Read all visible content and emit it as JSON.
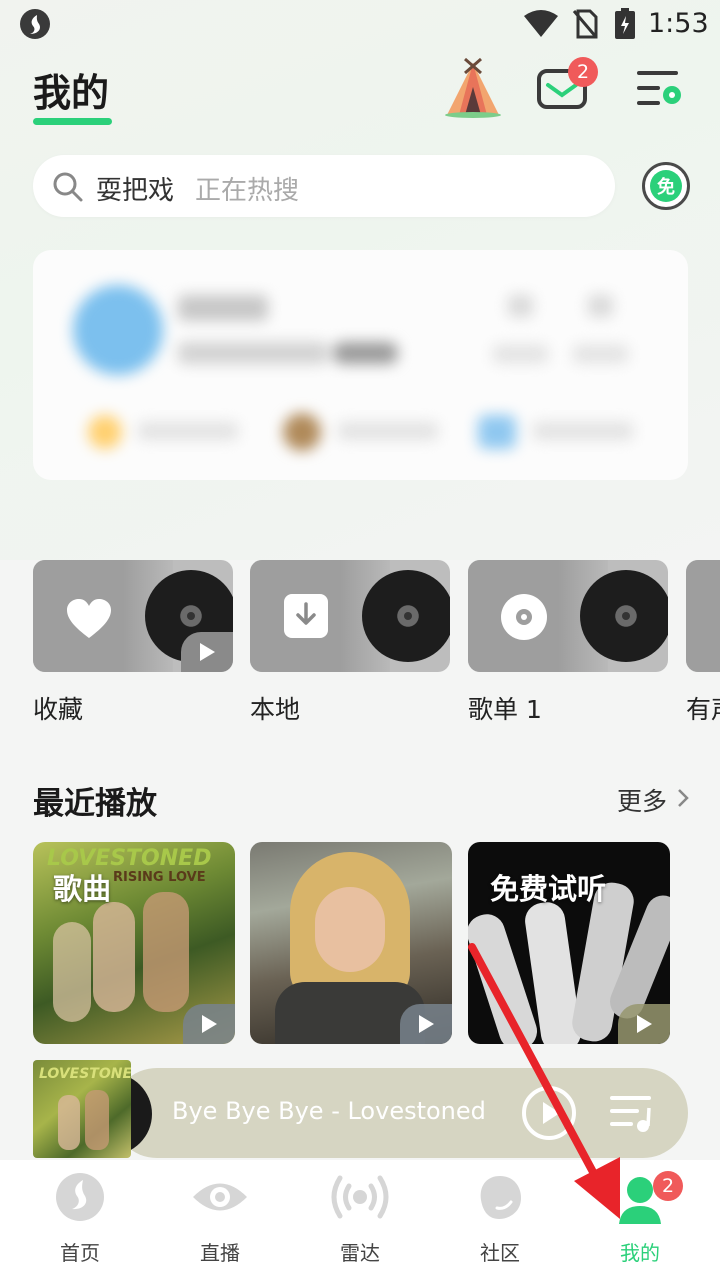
{
  "status_bar": {
    "time": "1:53"
  },
  "header": {
    "title": "我的",
    "mail_badge": "2"
  },
  "search": {
    "query": "耍把戏",
    "hint": "正在热搜",
    "free_label": "免"
  },
  "shortcuts": [
    {
      "label": "收藏",
      "icon": "heart-icon"
    },
    {
      "label": "本地",
      "icon": "download-icon"
    },
    {
      "label": "歌单 1",
      "icon": "disc-icon"
    },
    {
      "label": "有声",
      "icon": "audiobook-icon"
    }
  ],
  "recent": {
    "title": "最近播放",
    "more": "更多",
    "items": [
      {
        "tag": "歌曲",
        "art_text": "LOVESTONED",
        "art_subtext": "RISING LOVE"
      },
      {
        "tag": ""
      },
      {
        "tag": "免费试听"
      }
    ]
  },
  "player": {
    "title": "Bye Bye Bye - Lovestoned",
    "art_text": "LOVESTONED"
  },
  "nav": {
    "items": [
      {
        "label": "首页"
      },
      {
        "label": "直播"
      },
      {
        "label": "雷达"
      },
      {
        "label": "社区"
      },
      {
        "label": "我的"
      }
    ],
    "profile_badge": "2"
  },
  "colors": {
    "accent": "#2bd07a",
    "badge": "#f05a5a",
    "arrow": "#e8242a"
  }
}
